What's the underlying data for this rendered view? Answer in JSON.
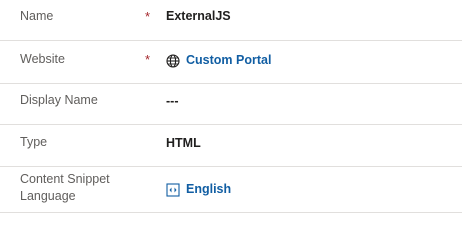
{
  "fields": [
    {
      "label": "Name",
      "required_mark": "*",
      "value": "ExternalJS"
    },
    {
      "label": "Website",
      "required_mark": "*",
      "value": "Custom Portal",
      "icon": "globe-icon"
    },
    {
      "label": "Display Name",
      "value": "---"
    },
    {
      "label": "Type",
      "value": "HTML"
    },
    {
      "label": "Content Snippet Language",
      "value": "English",
      "icon": "lookup-record-icon"
    }
  ],
  "colors": {
    "link": "#115ea3",
    "required": "#a4262c",
    "label": "#605e5c",
    "divider": "#e1dfdd"
  }
}
